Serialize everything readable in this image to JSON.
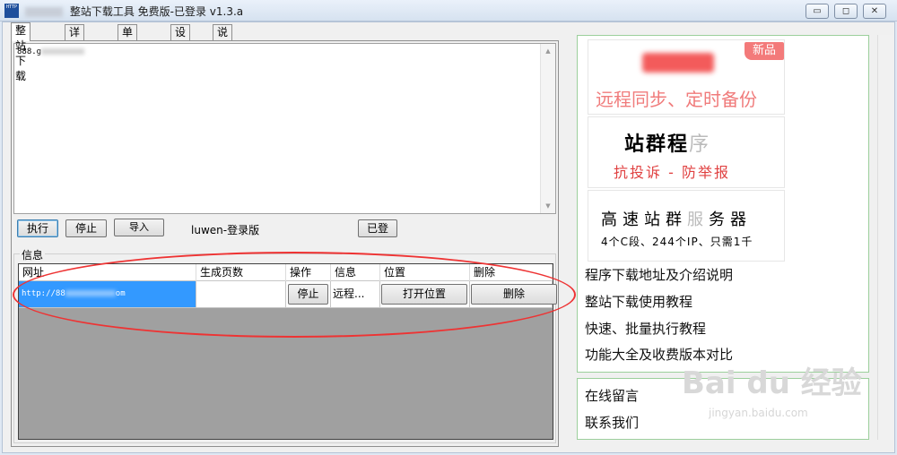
{
  "window": {
    "title": "整站下载工具 免费版-已登录  v1.3.a",
    "icon_text": "HTTP"
  },
  "tabs": [
    "整站下载",
    "详细信息",
    "单页下载",
    "设置",
    "说明"
  ],
  "url_input": {
    "value": "888.g"
  },
  "toolbar": {
    "execute": "执行",
    "stop": "停止",
    "import": "导入",
    "user_label": "luwen-登录版",
    "logged_in": "已登"
  },
  "info_group": {
    "title": "信息"
  },
  "table": {
    "columns": [
      "网址",
      "生成页数",
      "操作",
      "信息",
      "位置",
      "删除"
    ],
    "rows": [
      {
        "url": "http://88",
        "url_suffix": "om",
        "pages": "",
        "action": "停止",
        "info": "远程...",
        "location": "打开位置",
        "delete": "删除"
      }
    ]
  },
  "ads": {
    "ad1": {
      "badge": "新品",
      "text": "远程同步、定时备份"
    },
    "ad2": {
      "title": "站群程序",
      "title_fade": "序",
      "sub": "抗投诉 - 防举报"
    },
    "ad3": {
      "title_a": "高速站群",
      "title_fade": "服",
      "title_b": "务器",
      "sub": "4个C段、244个IP、只需1千"
    }
  },
  "links": [
    "程序下载地址及介绍说明",
    "整站下载使用教程",
    "快速、批量执行教程",
    "功能大全及收费版本对比"
  ],
  "bottom_links": [
    "在线留言",
    "联系我们"
  ],
  "watermark": {
    "text": "Bai du 经验",
    "sub": "jingyan.baidu.com"
  },
  "colors": {
    "selection": "#3399ff",
    "annotation": "#ee3333",
    "panel_border": "#9ccf9c"
  }
}
